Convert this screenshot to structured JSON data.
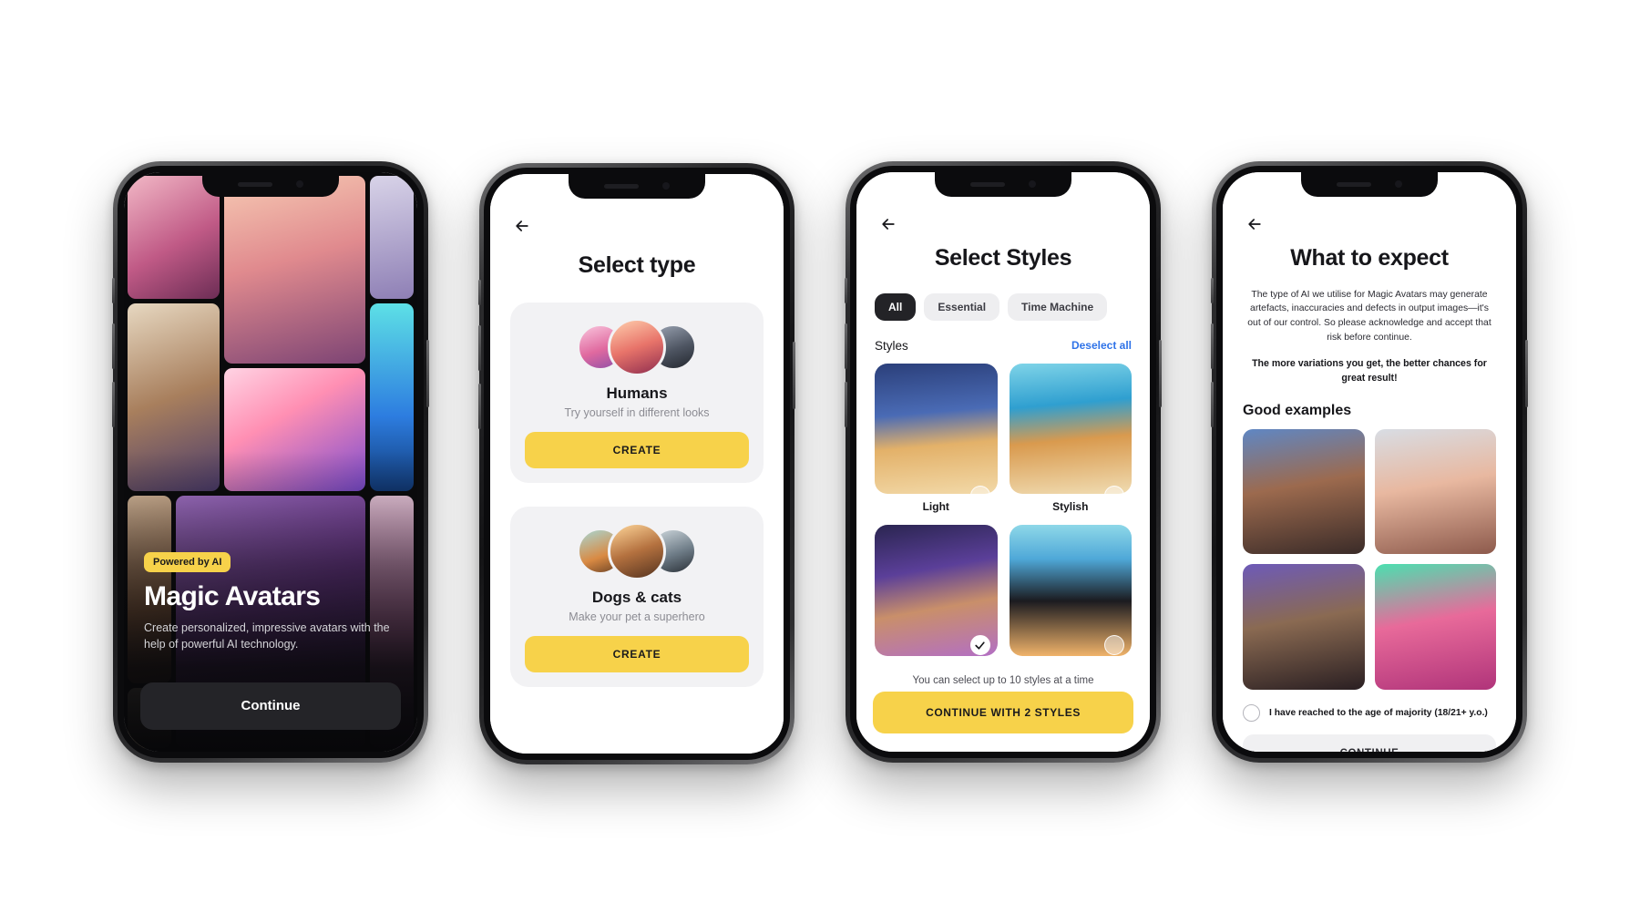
{
  "app": {
    "name": "Magic Avatars"
  },
  "accent": {
    "yellow": "#f7d24a",
    "dark": "#232327",
    "link_blue": "#2f73e8",
    "page_bg": "#ffffff"
  },
  "screens": [
    {
      "id": "onboarding-hero",
      "badge": "Powered by AI",
      "title": "Magic Avatars",
      "subtitle": "Create personalized, impressive avatars with the help of powerful AI technology.",
      "cta": "Continue"
    },
    {
      "id": "select-type",
      "back_icon": "back-arrow-icon",
      "title": "Select type",
      "cards": [
        {
          "title": "Humans",
          "subtitle": "Try yourself in different looks",
          "button": "CREATE",
          "avatars": [
            "pink-hair-woman",
            "red-hair-woman",
            "dark-hair-man"
          ]
        },
        {
          "title": "Dogs & cats",
          "subtitle": "Make your pet a superhero",
          "button": "CREATE",
          "avatars": [
            "shiba-dog",
            "collie-dog",
            "tuxedo-cat"
          ]
        }
      ]
    },
    {
      "id": "select-styles",
      "back_icon": "back-arrow-icon",
      "title": "Select Styles",
      "filters": [
        {
          "label": "All",
          "active": true
        },
        {
          "label": "Essential",
          "active": false
        },
        {
          "label": "Time Machine",
          "active": false
        }
      ],
      "section_label": "Styles",
      "deselect_all": "Deselect all",
      "styles": [
        {
          "name": "Light",
          "selected": false,
          "image": "pomeranian-snow-night"
        },
        {
          "name": "Stylish",
          "selected": false,
          "image": "pomeranian-beach"
        },
        {
          "name": "",
          "selected": true,
          "image": "pomeranian-galaxy"
        },
        {
          "name": "",
          "selected": false,
          "image": "black-cat-sunset"
        }
      ],
      "hint": "You can select up to 10 styles at a time",
      "cta": "CONTINUE WITH 2 STYLES"
    },
    {
      "id": "what-to-expect",
      "back_icon": "back-arrow-icon",
      "title": "What to expect",
      "body": "The type of AI we utilise for Magic Avatars may generate artefacts, inaccuracies and defects in output images—it's out of our control. So please acknowledge and accept that risk before continue.",
      "body_bold": "The more variations you get, the better chances for great result!",
      "section_title": "Good examples",
      "examples": [
        "man-desert-tattoo",
        "woman-cap-anime",
        "man-dreadlocks",
        "woman-pink-neon"
      ],
      "consent": "I have reached to the age of majority (18/21+ y.o.)",
      "cta": "CONTINUE"
    }
  ]
}
